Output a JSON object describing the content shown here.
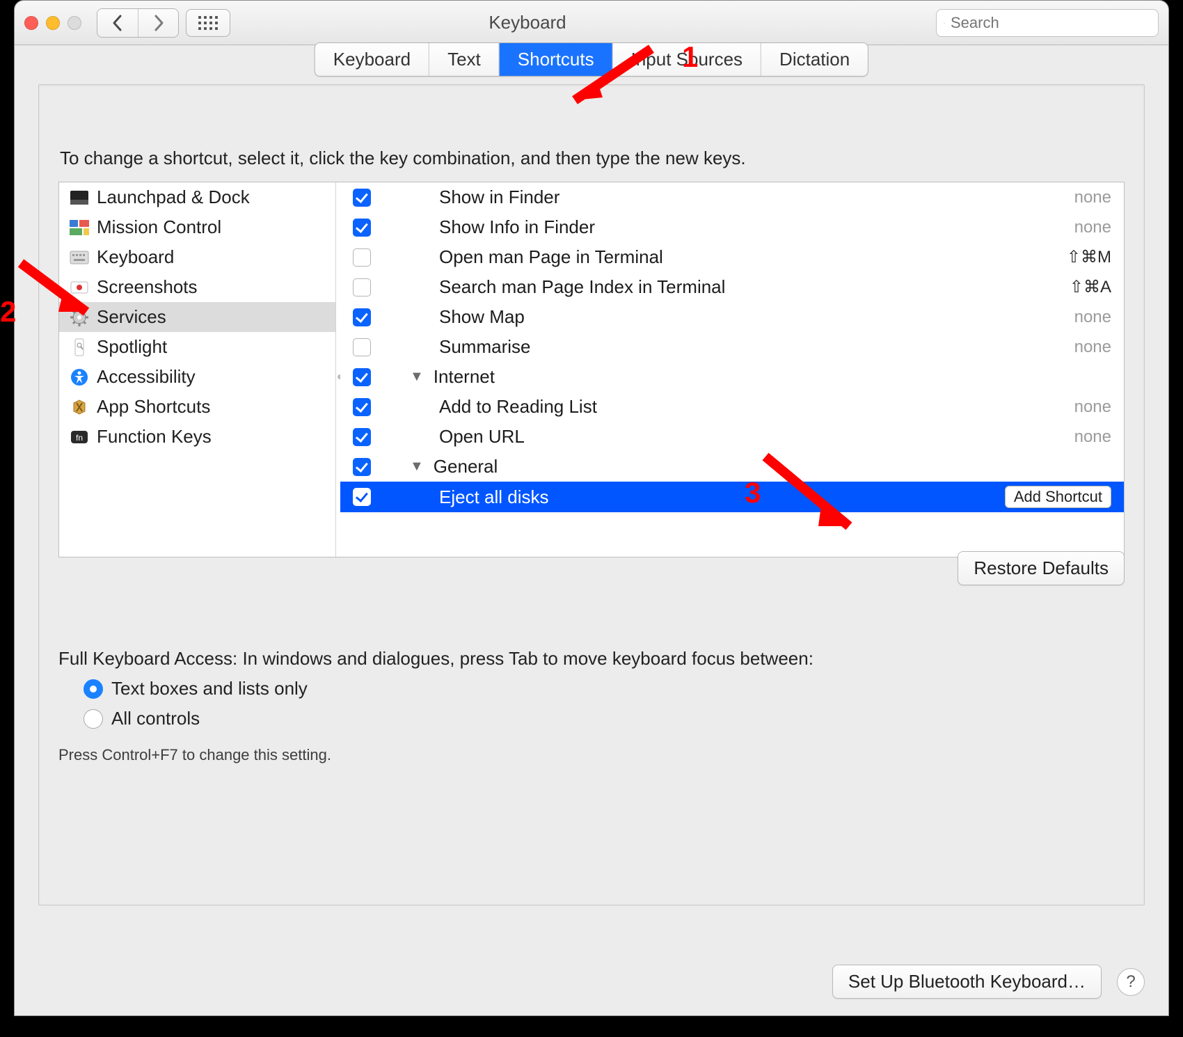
{
  "window": {
    "title": "Keyboard"
  },
  "toolbar": {
    "search_placeholder": "Search"
  },
  "tabs": {
    "items": [
      "Keyboard",
      "Text",
      "Shortcuts",
      "Input Sources",
      "Dictation"
    ],
    "active_index": 2
  },
  "hint": "To change a shortcut, select it, click the key combination, and then type the new keys.",
  "categories": [
    {
      "label": "Launchpad & Dock",
      "icon": "launchpad"
    },
    {
      "label": "Mission Control",
      "icon": "mission"
    },
    {
      "label": "Keyboard",
      "icon": "keyboard"
    },
    {
      "label": "Screenshots",
      "icon": "screenshots"
    },
    {
      "label": "Services",
      "icon": "gear",
      "selected": true
    },
    {
      "label": "Spotlight",
      "icon": "spotlight"
    },
    {
      "label": "Accessibility",
      "icon": "accessibility"
    },
    {
      "label": "App Shortcuts",
      "icon": "app"
    },
    {
      "label": "Function Keys",
      "icon": "fn"
    }
  ],
  "services": [
    {
      "checked": true,
      "indent": 2,
      "label": "Show in Finder",
      "shortcut": "none",
      "grey": true
    },
    {
      "checked": true,
      "indent": 2,
      "label": "Show Info in Finder",
      "shortcut": "none",
      "grey": true
    },
    {
      "checked": false,
      "indent": 2,
      "label": "Open man Page in Terminal",
      "shortcut": "⇧⌘M",
      "grey": false
    },
    {
      "checked": false,
      "indent": 2,
      "label": "Search man Page Index in Terminal",
      "shortcut": "⇧⌘A",
      "grey": false
    },
    {
      "checked": true,
      "indent": 2,
      "label": "Show Map",
      "shortcut": "none",
      "grey": true
    },
    {
      "checked": false,
      "indent": 2,
      "label": "Summarise",
      "shortcut": "none",
      "grey": true
    },
    {
      "checked": true,
      "indent": 1,
      "group": true,
      "label": "Internet"
    },
    {
      "checked": true,
      "indent": 2,
      "label": "Add to Reading List",
      "shortcut": "none",
      "grey": true
    },
    {
      "checked": true,
      "indent": 2,
      "label": "Open URL",
      "shortcut": "none",
      "grey": true
    },
    {
      "checked": true,
      "indent": 1,
      "group": true,
      "label": "General"
    },
    {
      "checked": true,
      "indent": 2,
      "label": "Eject all disks",
      "selected": true,
      "add_button": "Add Shortcut"
    }
  ],
  "restore_label": "Restore Defaults",
  "fka": {
    "heading": "Full Keyboard Access: In windows and dialogues, press Tab to move keyboard focus between:",
    "opt1": "Text boxes and lists only",
    "opt2": "All controls",
    "sub": "Press Control+F7 to change this setting."
  },
  "footer": {
    "bluetooth": "Set Up Bluetooth Keyboard…",
    "help": "?"
  },
  "annotations": {
    "n1": "1",
    "n2": "2",
    "n3": "3"
  }
}
